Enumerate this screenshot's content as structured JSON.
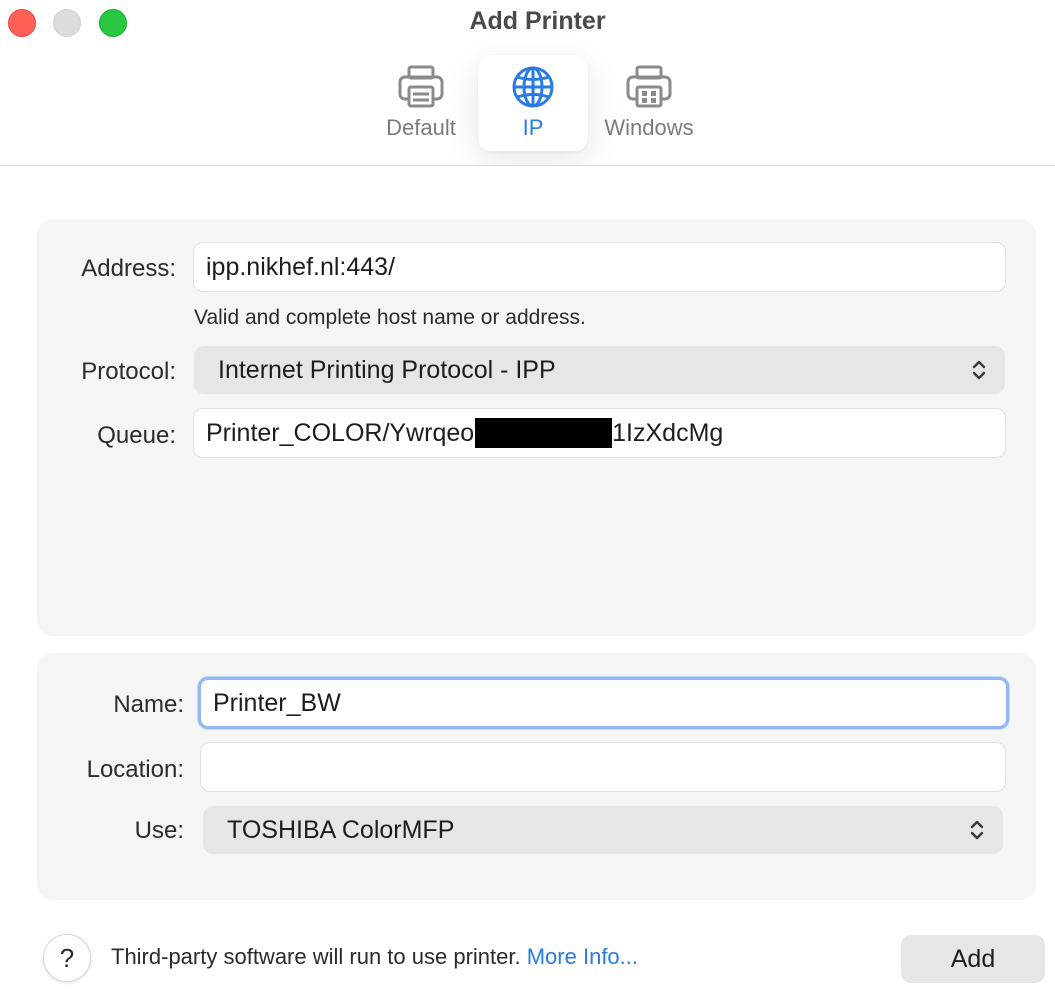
{
  "window": {
    "title": "Add Printer",
    "controls": [
      "close",
      "minimize",
      "zoom"
    ]
  },
  "tabs": [
    {
      "label": "Default",
      "icon": "printer-icon",
      "selected": false
    },
    {
      "label": "IP",
      "icon": "globe-icon",
      "selected": true
    },
    {
      "label": "Windows",
      "icon": "windows-printer-icon",
      "selected": false
    }
  ],
  "connection": {
    "address_label": "Address:",
    "address_value": "ipp.nikhef.nl:443/",
    "address_hint": "Valid and complete host name or address.",
    "protocol_label": "Protocol:",
    "protocol_value": "Internet Printing Protocol - IPP",
    "queue_label": "Queue:",
    "queue_value_start": "Printer_COLOR/Ywrqeo",
    "queue_value_end": "1IzXdcMg"
  },
  "details": {
    "name_label": "Name:",
    "name_value": "Printer_BW",
    "location_label": "Location:",
    "location_value": "",
    "use_label": "Use:",
    "use_value": "TOSHIBA ColorMFP"
  },
  "footer": {
    "help_label": "?",
    "notice": "Third-party software will run to use printer.",
    "more_info": "More Info...",
    "add_label": "Add"
  },
  "colors": {
    "accent": "#2a7ae4",
    "close": "#fe5f57",
    "zoom": "#28c840",
    "focus_ring": "#93b7f2"
  }
}
